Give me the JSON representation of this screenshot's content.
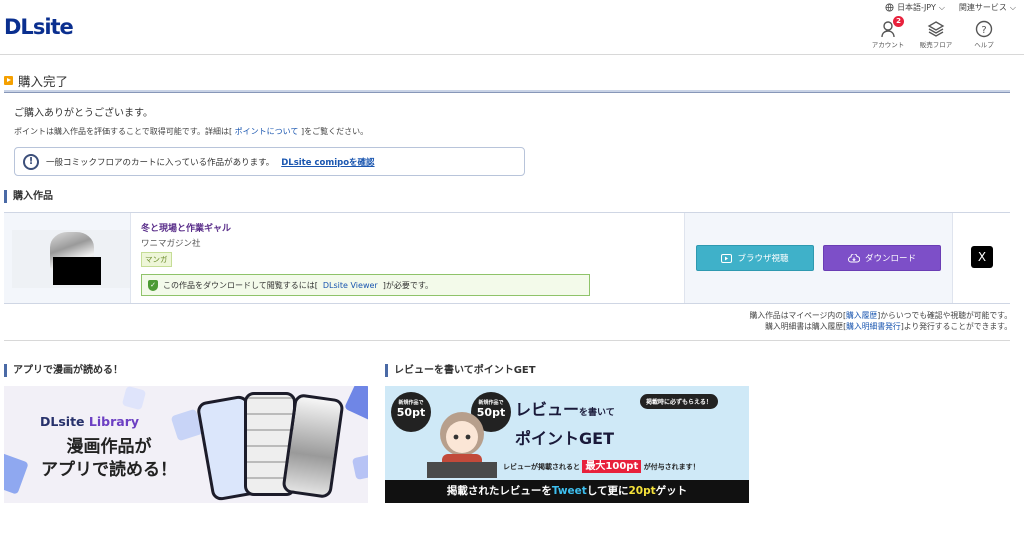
{
  "header": {
    "logo": "DLsite",
    "language": "日本語-JPY",
    "related_services": "関連サービス",
    "account_label": "アカウント",
    "account_badge": "2",
    "floor_label": "販売フロア",
    "help_label": "ヘルプ"
  },
  "page": {
    "title": "購入完了",
    "thanks": "ご購入ありがとうございます。",
    "point_note_prefix": "ポイントは購入作品を評価することで取得可能です。詳細は[",
    "point_note_link": "ポイントについて",
    "point_note_suffix": "]をご覧ください。",
    "info_text": "一般コミックフロアのカートに入っている作品があります。",
    "info_link": "DLsite comipoを確認"
  },
  "purchased": {
    "section_title": "購入作品",
    "product": {
      "title": "冬と現場と作業ギャル",
      "circle": "ワニマガジン社",
      "genre": "マンガ",
      "viewer_prefix": "この作品をダウンロードして閲覧するには[",
      "viewer_link": "DLsite Viewer",
      "viewer_suffix": "]が必要です。",
      "browser_button": "ブラウザ視聴",
      "download_button": "ダウンロード",
      "share_icon": "X"
    },
    "history_line1_prefix": "購入作品はマイページ内の[",
    "history_line1_link": "購入履歴",
    "history_line1_suffix": "]からいつでも確認や視聴が可能です。",
    "history_line2_prefix": "購入明細書は購入履歴[",
    "history_line2_link": "購入明細書発行",
    "history_line2_suffix": "]より発行することができます。"
  },
  "banners": {
    "app_title": "アプリで漫画が読める！",
    "app_logo_a": "DLsite",
    "app_logo_b": "Library",
    "app_line1": "漫画作品が",
    "app_line2": "アプリで読める！",
    "review_title": "レビューを書いてポイントGET",
    "review_badge1_top": "新規作品で",
    "review_badge1_val": "50pt",
    "review_badge2_top": "新規作品で",
    "review_badge2_val": "50pt",
    "review_tag": "掲載時に必ずもらえる！",
    "review_head1": "レビュー",
    "review_head1_small": "を書いて",
    "review_head2": "ポイントGET",
    "review_sub_prefix": "レビューが掲載されると",
    "review_sub_big": "最大100pt",
    "review_sub_suffix": "が付与されます！",
    "review_bottom_a": "掲載されたレビューを",
    "review_bottom_tw": "Tweet",
    "review_bottom_b": "して更に",
    "review_bottom_pt": "20pt",
    "review_bottom_c": "ゲット"
  }
}
